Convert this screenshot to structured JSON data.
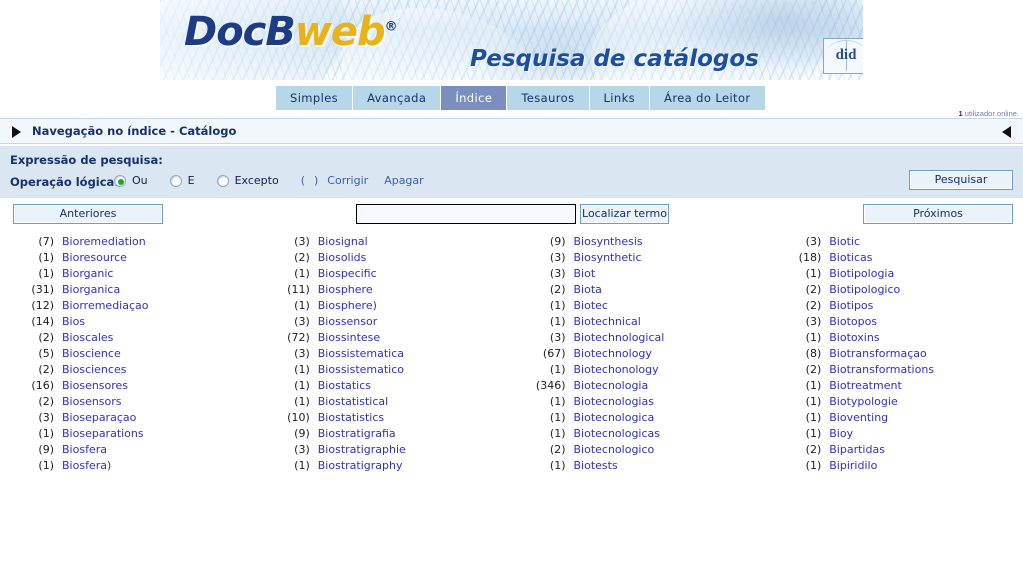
{
  "banner": {
    "logo_part1": "DocB",
    "logo_part2": "web",
    "logo_reg": "®",
    "subtitle": "Pesquisa de catálogos",
    "partner_logo_text": "did"
  },
  "tabs": [
    {
      "label": "Simples",
      "active": false
    },
    {
      "label": "Avançada",
      "active": false
    },
    {
      "label": "Índice",
      "active": true
    },
    {
      "label": "Tesauros",
      "active": false
    },
    {
      "label": "Links",
      "active": false
    },
    {
      "label": "Área do Leitor",
      "active": false
    }
  ],
  "status": {
    "online_count": "1",
    "online_text": "utilizador online."
  },
  "breadcrumb": {
    "text": "Navegação no índice - Catálogo"
  },
  "expression_panel": {
    "expression_label": "Expressão de pesquisa:",
    "expression_value": "",
    "operation_label": "Operação lógica:",
    "radios": [
      {
        "label": "Ou",
        "selected": true
      },
      {
        "label": "E",
        "selected": false
      },
      {
        "label": "Excepto",
        "selected": false
      }
    ],
    "paren_open": "(",
    "paren_close": ")",
    "links": [
      "Corrigir",
      "Apagar"
    ],
    "search_button": "Pesquisar"
  },
  "toolbar": {
    "previous_label": "Anteriores",
    "next_label": "Próximos",
    "find_button_label": "Localizar termo",
    "find_input_value": "",
    "find_input_placeholder": ""
  },
  "colors": {
    "tab_bg": "#b6d7e8",
    "tab_active_bg": "#7a8fc0",
    "panel_bg": "#dbe6f3",
    "crumb_bg": "#f2f7fc",
    "link": "#2f2fc8",
    "navy": "#16316b",
    "gold": "#e8b21b",
    "radio_selected": "#1ba81b"
  },
  "index_columns": [
    [
      {
        "count": "(7)",
        "term": "Bioremediation"
      },
      {
        "count": "(1)",
        "term": "Bioresource"
      },
      {
        "count": "(1)",
        "term": "Biorganic"
      },
      {
        "count": "(31)",
        "term": "Biorganica"
      },
      {
        "count": "(12)",
        "term": "Biorremediaçao"
      },
      {
        "count": "(14)",
        "term": "Bios"
      },
      {
        "count": "(2)",
        "term": "Bioscales"
      },
      {
        "count": "(5)",
        "term": "Bioscience"
      },
      {
        "count": "(2)",
        "term": "Biosciences"
      },
      {
        "count": "(16)",
        "term": "Biosensores"
      },
      {
        "count": "(2)",
        "term": "Biosensors"
      },
      {
        "count": "(3)",
        "term": "Bioseparaçao"
      },
      {
        "count": "(1)",
        "term": "Bioseparations"
      },
      {
        "count": "(9)",
        "term": "Biosfera"
      },
      {
        "count": "(1)",
        "term": "Biosfera)"
      }
    ],
    [
      {
        "count": "(3)",
        "term": "Biosignal"
      },
      {
        "count": "(2)",
        "term": "Biosolids"
      },
      {
        "count": "(1)",
        "term": "Biospecific"
      },
      {
        "count": "(11)",
        "term": "Biosphere"
      },
      {
        "count": "(1)",
        "term": "Biosphere)"
      },
      {
        "count": "(3)",
        "term": "Biossensor"
      },
      {
        "count": "(72)",
        "term": "Biossintese"
      },
      {
        "count": "(3)",
        "term": "Biossistematica"
      },
      {
        "count": "(1)",
        "term": "Biossistematico"
      },
      {
        "count": "(1)",
        "term": "Biostatics"
      },
      {
        "count": "(1)",
        "term": "Biostatistical"
      },
      {
        "count": "(10)",
        "term": "Biostatistics"
      },
      {
        "count": "(9)",
        "term": "Biostratigrafia"
      },
      {
        "count": "(3)",
        "term": "Biostratigraphie"
      },
      {
        "count": "(1)",
        "term": "Biostratigraphy"
      }
    ],
    [
      {
        "count": "(9)",
        "term": "Biosynthesis"
      },
      {
        "count": "(3)",
        "term": "Biosynthetic"
      },
      {
        "count": "(3)",
        "term": "Biot"
      },
      {
        "count": "(2)",
        "term": "Biota"
      },
      {
        "count": "(1)",
        "term": "Biotec"
      },
      {
        "count": "(1)",
        "term": "Biotechnical"
      },
      {
        "count": "(3)",
        "term": "Biotechnological"
      },
      {
        "count": "(67)",
        "term": "Biotechnology"
      },
      {
        "count": "(1)",
        "term": "Biotechonology"
      },
      {
        "count": "(346)",
        "term": "Biotecnologia"
      },
      {
        "count": "(1)",
        "term": "Biotecnologias"
      },
      {
        "count": "(1)",
        "term": "Biotecnologica"
      },
      {
        "count": "(1)",
        "term": "Biotecnologicas"
      },
      {
        "count": "(2)",
        "term": "Biotecnologico"
      },
      {
        "count": "(1)",
        "term": "Biotests"
      }
    ],
    [
      {
        "count": "(3)",
        "term": "Biotic"
      },
      {
        "count": "(18)",
        "term": "Bioticas"
      },
      {
        "count": "(1)",
        "term": "Biotipologia"
      },
      {
        "count": "(2)",
        "term": "Biotipologico"
      },
      {
        "count": "(2)",
        "term": "Biotipos"
      },
      {
        "count": "(3)",
        "term": "Biotopos"
      },
      {
        "count": "(1)",
        "term": "Biotoxins"
      },
      {
        "count": "(8)",
        "term": "Biotransformaçao"
      },
      {
        "count": "(2)",
        "term": "Biotransformations"
      },
      {
        "count": "(1)",
        "term": "Biotreatment"
      },
      {
        "count": "(1)",
        "term": "Biotypologie"
      },
      {
        "count": "(1)",
        "term": "Bioventing"
      },
      {
        "count": "(1)",
        "term": "Bioy"
      },
      {
        "count": "(2)",
        "term": "Bipartidas"
      },
      {
        "count": "(1)",
        "term": "Bipiridilo"
      }
    ]
  ]
}
